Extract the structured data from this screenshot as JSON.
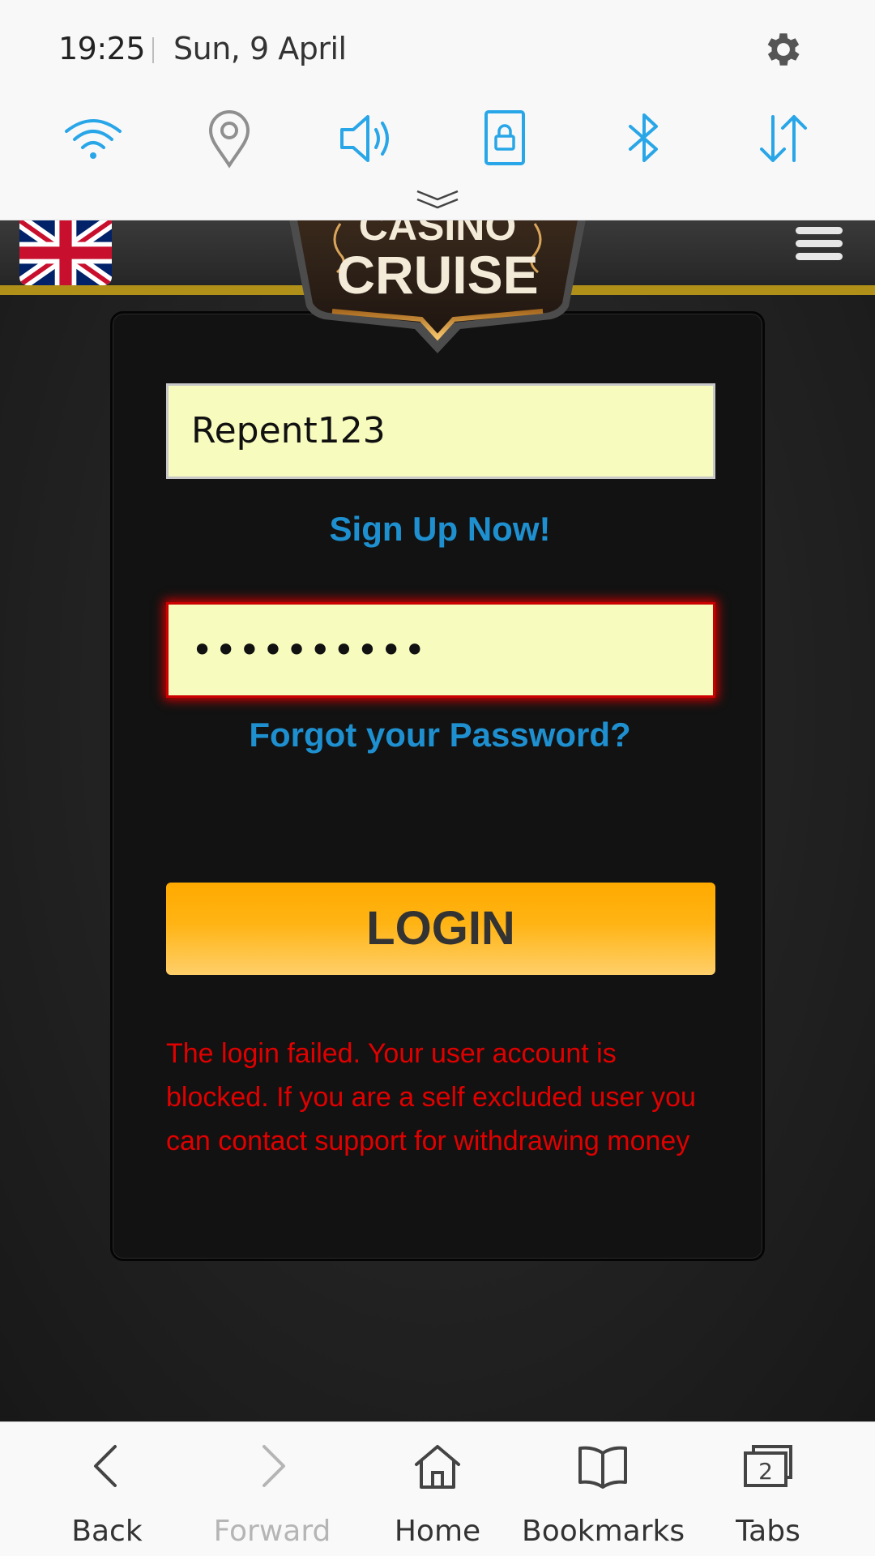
{
  "status": {
    "time": "19:25",
    "date": "Sun, 9 April"
  },
  "quick_settings": [
    "wifi-icon",
    "location-icon",
    "sound-icon",
    "screen-lock-icon",
    "bluetooth-icon",
    "mobile-data-icon"
  ],
  "site": {
    "logo_text_top": "CASINO",
    "logo_text_bottom": "CRUISE",
    "username_value": "Repent123",
    "password_value": "••••••••••",
    "signup_label": "Sign Up Now!",
    "forgot_label": "Forgot your Password?",
    "login_label": "LOGIN",
    "error_message": "The login failed. Your user account is blocked. If you are a self excluded user you can contact support for withdrawing money"
  },
  "bottom_nav": {
    "back": "Back",
    "forward": "Forward",
    "home": "Home",
    "bookmarks": "Bookmarks",
    "tabs": "Tabs",
    "tab_count": "2"
  },
  "colors": {
    "accent_blue": "#1e90d0",
    "qs_icon": "#29a6e8",
    "error_red": "#e00000",
    "login_orange": "#ffaa00",
    "input_bg": "#f8fbbe"
  }
}
